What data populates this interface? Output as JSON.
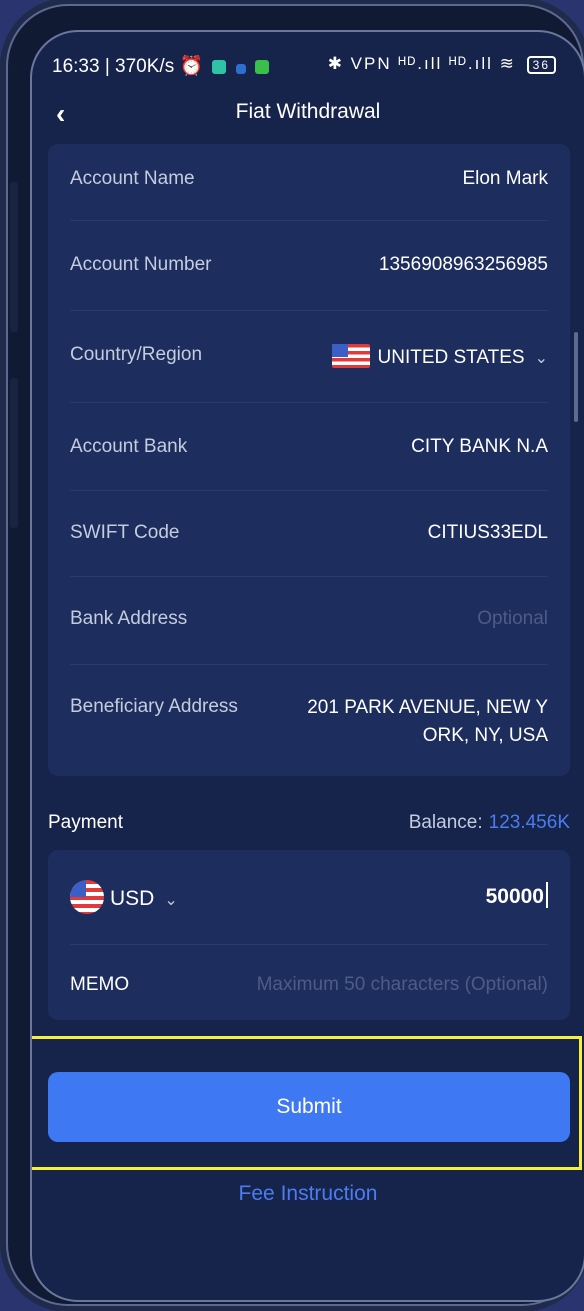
{
  "status_bar": {
    "time": "16:33 | 370K/s",
    "right_icons": "✱ VPN ᴴᴰ.ıll ᴴᴰ.ıll ≋",
    "battery": "36"
  },
  "header": {
    "back_icon": "chevron-left-icon",
    "title": "Fiat Withdrawal"
  },
  "form": {
    "account_name": {
      "label": "Account Name",
      "value": "Elon Mark"
    },
    "account_number": {
      "label": "Account Number",
      "value": "1356908963256985"
    },
    "country": {
      "label": "Country/Region",
      "value": "UNITED STATES"
    },
    "account_bank": {
      "label": "Account Bank",
      "value": "CITY BANK N.A"
    },
    "swift": {
      "label": "SWIFT Code",
      "value": "CITIUS33EDL"
    },
    "bank_address": {
      "label": "Bank Address",
      "placeholder": "Optional"
    },
    "beneficiary_address": {
      "label": "Beneficiary Address",
      "value_line1": "201 PARK AVENUE, NEW Y",
      "value_line2": "ORK, NY, USA"
    }
  },
  "payment": {
    "label": "Payment",
    "balance_label": "Balance:",
    "balance_value": "123.456K",
    "currency": "USD",
    "amount": "50000",
    "memo_label": "MEMO",
    "memo_placeholder": "Maximum 50 characters (Optional)"
  },
  "submit_label": "Submit",
  "fee_link": "Fee Instruction",
  "colors": {
    "accent": "#3e78f2",
    "background": "#16234b",
    "card": "#1d2d5e",
    "highlight": "#f6f038"
  }
}
